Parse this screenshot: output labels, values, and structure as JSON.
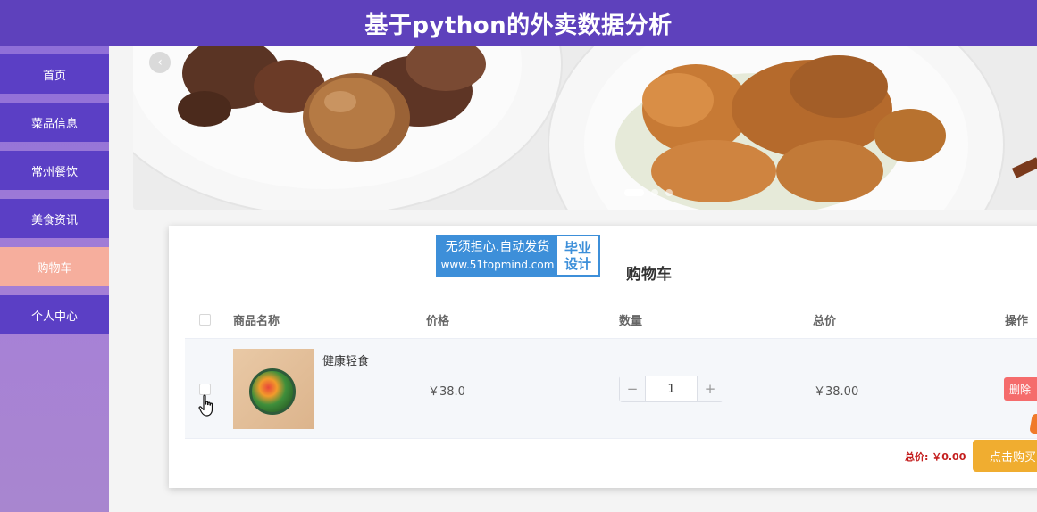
{
  "header": {
    "title": "基于python的外卖数据分析"
  },
  "sidebar": {
    "items": [
      {
        "label": "首页",
        "active": false
      },
      {
        "label": "菜品信息",
        "active": false
      },
      {
        "label": "常州餐饮",
        "active": false
      },
      {
        "label": "美食资讯",
        "active": false
      },
      {
        "label": "购物车",
        "active": true
      },
      {
        "label": "个人中心",
        "active": false
      }
    ]
  },
  "banner": {
    "slides": 3,
    "active_slide": 1
  },
  "watermark": {
    "line1": "无须担心.自动发货",
    "line2": "www.51topmind.com",
    "right_line1": "毕业",
    "right_line2": "设计"
  },
  "cart": {
    "title": "购物车",
    "columns": {
      "name": "商品名称",
      "price": "价格",
      "quantity": "数量",
      "subtotal": "总价",
      "actions": "操作"
    },
    "items": [
      {
        "name": "健康轻食",
        "price": "￥38.0",
        "quantity": "1",
        "subtotal": "￥38.00",
        "delete_label": "删除",
        "checked": false
      }
    ],
    "total_label": "总价: ￥0.00",
    "buy_label": "点击购买",
    "stepper": {
      "minus": "−",
      "plus": "+"
    }
  },
  "colors": {
    "header_bg": "#5e41bc",
    "nav_bg": "#5b3fc5",
    "nav_active_bg": "#f6ae9d",
    "delete_bg": "#f56c6c",
    "buy_bg": "#f0ad30",
    "total_text": "#c41e1e"
  }
}
